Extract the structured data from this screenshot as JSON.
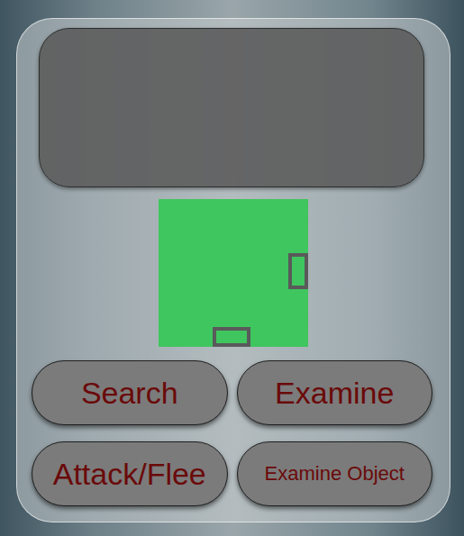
{
  "message_box": {
    "empty": true
  },
  "map": {
    "exits": [
      {
        "kind": "east"
      },
      {
        "kind": "south"
      }
    ]
  },
  "buttons": [
    {
      "label": "Search"
    },
    {
      "label": "Examine"
    },
    {
      "label": "Attack/Flee"
    },
    {
      "label": "Examine Object"
    }
  ]
}
